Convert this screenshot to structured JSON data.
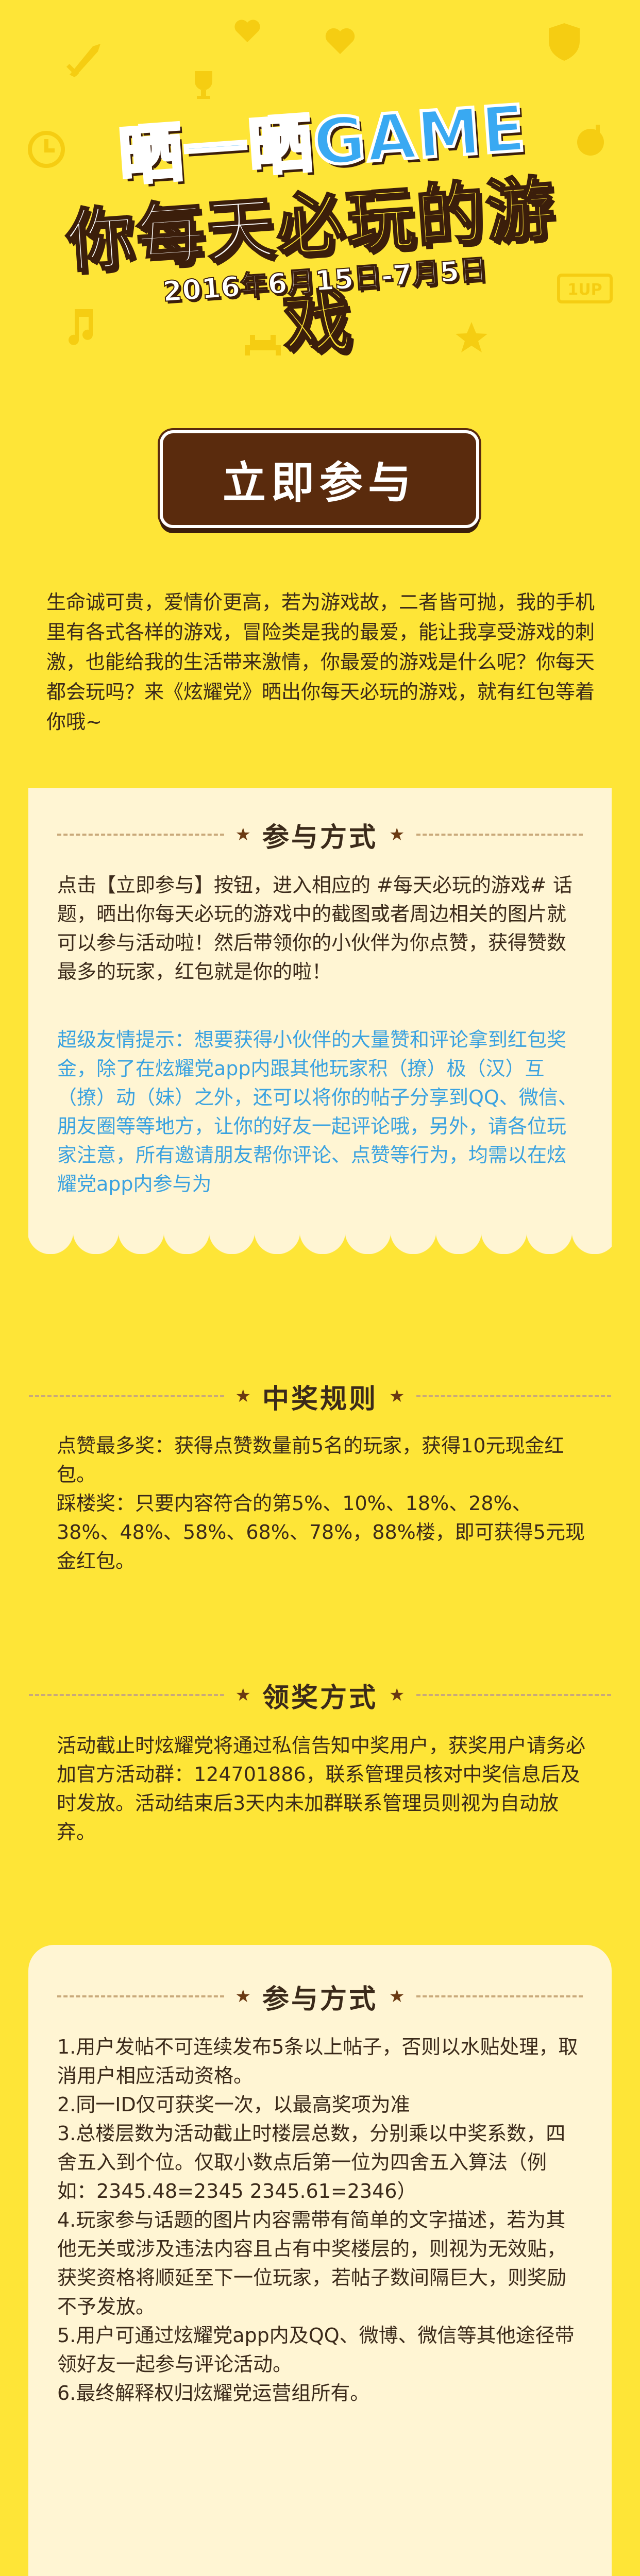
{
  "hero": {
    "title_line1": "晒一晒GAME",
    "title_line2_a": "你每天",
    "title_line2_b": "必玩的游戏",
    "date_range": "2016年6月15日-7月5日"
  },
  "join_button_label": "立即参与",
  "intro_text": "生命诚可贵，爱情价更高，若为游戏故，二者皆可抛，我的手机里有各式各样的游戏，冒险类是我的最爱，能让我享受游戏的刺激，也能给我的生活带来激情，你最爱的游戏是什么呢？你每天都会玩吗？来《炫耀党》晒出你每天必玩的游戏，就有红包等着你哦~",
  "section_participate": {
    "heading": "参与方式",
    "paragraph": "点击【立即参与】按钮，进入相应的 #每天必玩的游戏# 话题，晒出你每天必玩的游戏中的截图或者周边相关的图片就可以参与活动啦！然后带领你的小伙伴为你点赞，获得赞数最多的玩家，红包就是你的啦！",
    "tip": "超级友情提示：想要获得小伙伴的大量赞和评论拿到红包奖金，除了在炫耀党app内跟其他玩家积（撩）极（汉）互（撩）动（妹）之外，还可以将你的帖子分享到QQ、微信、朋友圈等等地方，让你的好友一起评论哦，另外，请各位玩家注意，所有邀请朋友帮你评论、点赞等行为，均需以在炫耀党app内参与为"
  },
  "section_rules": {
    "heading": "中奖规则",
    "text": "点赞最多奖：获得点赞数量前5名的玩家，获得10元现金红包。\n踩楼奖：只要内容符合的第5%、10%、18%、28%、38%、48%、58%、68%、78%，88%楼，即可获得5元现金红包。"
  },
  "section_claim": {
    "heading": "领奖方式",
    "text": "活动截止时炫耀党将通过私信告知中奖用户，获奖用户请务必加官方活动群：124701886，联系管理员核对中奖信息后及时发放。活动结束后3天内未加群联系管理员则视为自动放弃。"
  },
  "section_notes": {
    "heading": "参与方式",
    "items": [
      "1.用户发帖不可连续发布5条以上帖子，否则以水贴处理，取消用户相应活动资格。",
      "2.同一ID仅可获奖一次，以最高奖项为准",
      "3.总楼层数为活动截止时楼层总数，分别乘以中奖系数，四舍五入到个位。仅取小数点后第一位为四舍五入算法（例如：2345.48=2345 2345.61=2346）",
      "4.玩家参与话题的图片内容需带有简单的文字描述，若为其他无关或涉及违法内容且占有中奖楼层的，则视为无效贴，获奖资格将顺延至下一位玩家，若帖子数间隔巨大，则奖励不予发放。",
      "5.用户可通过炫耀党app内及QQ、微博、微信等其他途径带领好友一起参与评论活动。",
      "6.最终解释权归炫耀党运营组所有。"
    ]
  },
  "colors": {
    "background": "#fee537",
    "card": "#fff5d3",
    "brown": "#5a2b0d",
    "title_blue": "#39a9f2",
    "tip_blue": "#3aa2e0"
  }
}
